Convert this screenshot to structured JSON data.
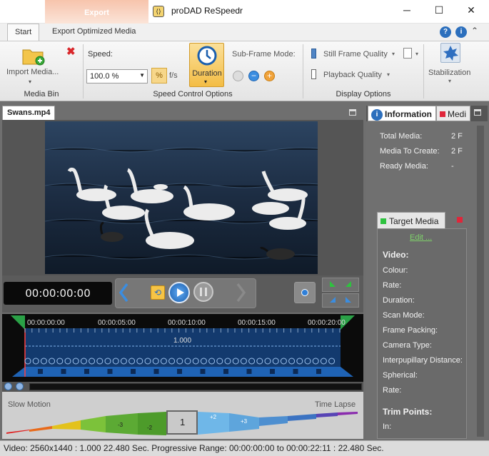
{
  "window": {
    "title": "proDAD ReSpeedr",
    "context_tab": "Export",
    "buttons": [
      "minimize",
      "maximize",
      "close"
    ]
  },
  "ribbon_tabs": [
    {
      "label": "Start",
      "active": true
    },
    {
      "label": "Export Optimized Media",
      "active": false
    }
  ],
  "ribbon": {
    "media_bin": {
      "import_label": "Import Media...",
      "group_label": "Media Bin"
    },
    "speed_control": {
      "speed_label": "Speed:",
      "speed_value": "100.0 %",
      "percent_button": "%",
      "fps_label": "f/s",
      "duration_label": "Duration",
      "subframe_label": "Sub-Frame Mode:",
      "group_label": "Speed Control Options"
    },
    "display": {
      "still_frame_quality": "Still Frame Quality",
      "playback_quality": "Playback Quality",
      "group_label": "Display Options"
    },
    "stabilization_label": "Stabilization"
  },
  "clip_tab": "Swans.mp4",
  "transport": {
    "timecode": "00:00:00:00"
  },
  "timeline": {
    "ticks": [
      "00:00:00:00",
      "00:00:05:00",
      "00:00:10:00",
      "00:00:15:00",
      "00:00:20:00"
    ],
    "speed_value": "1.000"
  },
  "speed_curve": {
    "left_label": "Slow Motion",
    "right_label": "Time Lapse",
    "segments": [
      "-3",
      "-2",
      "1",
      "+2",
      "+3"
    ],
    "selected": "1"
  },
  "right_panel": {
    "tabs": [
      "Information",
      "Medi"
    ],
    "info_rows": [
      {
        "label": "Total Media:",
        "value": "2 F"
      },
      {
        "label": "Media To Create:",
        "value": "2 F"
      },
      {
        "label": "Ready Media:",
        "value": "-"
      }
    ],
    "target_tab": "Target Media",
    "edit_link": "Edit ...",
    "video_heading": "Video:",
    "video_rows": [
      "Colour:",
      "Rate:",
      "Duration:",
      "Scan Mode:",
      "Frame Packing:",
      "Camera Type:",
      "Interpupillary Distance:",
      "Spherical:",
      "Rate:"
    ],
    "trim_heading": "Trim Points:",
    "trim_rows": [
      "In:"
    ]
  },
  "status_bar": "Video: 2560x1440 : 1.000  22.480 Sec.  Progressive  Range: 00:00:00:00 to 00:00:22:11 : 22.480 Sec.",
  "colors": {
    "timeline_blue": "#1f63b5",
    "accent_orange": "#f0a23a",
    "export_tab": "#f7c4ac"
  }
}
